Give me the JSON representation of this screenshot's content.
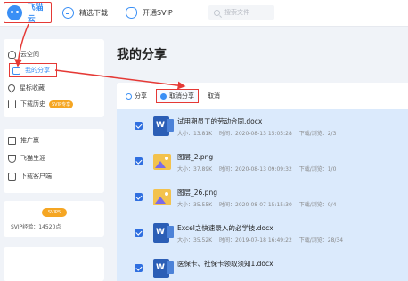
{
  "header": {
    "logo_text": "飞猫云",
    "nav": [
      {
        "label": "精选下载",
        "icon": "download-circle-icon"
      },
      {
        "label": "开通SVIP",
        "icon": "crown-icon"
      }
    ],
    "search_placeholder": "搜索文件"
  },
  "sidebar": {
    "group1": [
      {
        "label": "云空间",
        "icon": "cloud-icon"
      },
      {
        "label": "我的分享",
        "icon": "share-icon",
        "active": true
      },
      {
        "label": "星标收藏",
        "icon": "heart-icon"
      },
      {
        "label": "下载历史",
        "icon": "download-history-icon",
        "badge": "SVIP专享"
      }
    ],
    "group2": [
      {
        "label": "推广赢",
        "icon": "promo-icon"
      },
      {
        "label": "飞猫生涯",
        "icon": "trophy-icon"
      },
      {
        "label": "下载客户端",
        "icon": "client-icon"
      }
    ],
    "vip": {
      "badge": "SVIP5",
      "expire_text": "SVIP经验：14520点"
    }
  },
  "main": {
    "title": "我的分享",
    "toolbar": {
      "share": "分享",
      "cancel_share": "取消分享",
      "cancel": "取消"
    },
    "files": [
      {
        "name": "试用期员工的劳动合同.docx",
        "size": "大小：13.81K",
        "time": "时间：2020-08-13 15:05:28",
        "stats": "下载/浏览：2/3",
        "type": "word"
      },
      {
        "name": "图层_2.png",
        "size": "大小：37.89K",
        "time": "时间：2020-08-13 09:09:32",
        "stats": "下载/浏览：1/0",
        "type": "image"
      },
      {
        "name": "图层_26.png",
        "size": "大小：35.55K",
        "time": "时间：2020-08-07 15:15:30",
        "stats": "下载/浏览：0/4",
        "type": "image"
      },
      {
        "name": "Excel之快速录入的必学技.docx",
        "size": "大小：35.52K",
        "time": "时间：2019-07-18 16:49:22",
        "stats": "下载/浏览：28/34",
        "type": "word"
      },
      {
        "name": "医保卡、社保卡领取须知1.docx",
        "size": "",
        "time": "",
        "stats": "",
        "type": "word"
      }
    ]
  },
  "colors": {
    "accent": "#3a8ff5",
    "highlight_border": "#e53935",
    "selected_row": "#dbeafc",
    "vip": "#f5a623"
  }
}
